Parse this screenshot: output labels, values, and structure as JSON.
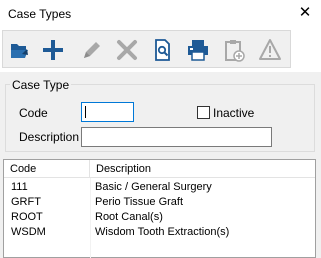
{
  "window": {
    "title": "Case Types",
    "close_glyph": "✕"
  },
  "toolbar": {
    "buttons": [
      {
        "icon": "open-folder-icon",
        "enabled": true
      },
      {
        "icon": "add-plus-icon",
        "enabled": true
      },
      {
        "icon": "edit-pencil-icon",
        "enabled": false
      },
      {
        "icon": "delete-x-icon",
        "enabled": false
      },
      {
        "icon": "preview-icon",
        "enabled": true
      },
      {
        "icon": "printer-icon",
        "enabled": true
      },
      {
        "icon": "clipboard-add-icon",
        "enabled": false
      },
      {
        "icon": "warning-icon",
        "enabled": false
      }
    ]
  },
  "case_type": {
    "group_label": "Case Type",
    "code_label": "Code",
    "code_value": "",
    "inactive_label": "Inactive",
    "inactive_checked": false,
    "description_label": "Description",
    "description_value": ""
  },
  "table": {
    "columns": [
      "Code",
      "Description"
    ],
    "rows": [
      {
        "code": "111",
        "description": "Basic / General Surgery"
      },
      {
        "code": "GRFT",
        "description": "Perio Tissue Graft"
      },
      {
        "code": "ROOT",
        "description": "Root Canal(s)"
      },
      {
        "code": "WSDM",
        "description": "Wisdom Tooth Extraction(s)"
      }
    ]
  },
  "colors": {
    "accent_blue": "#1e5a96",
    "disabled_gray": "#a8a8a8",
    "focus_border": "#0078d7"
  }
}
